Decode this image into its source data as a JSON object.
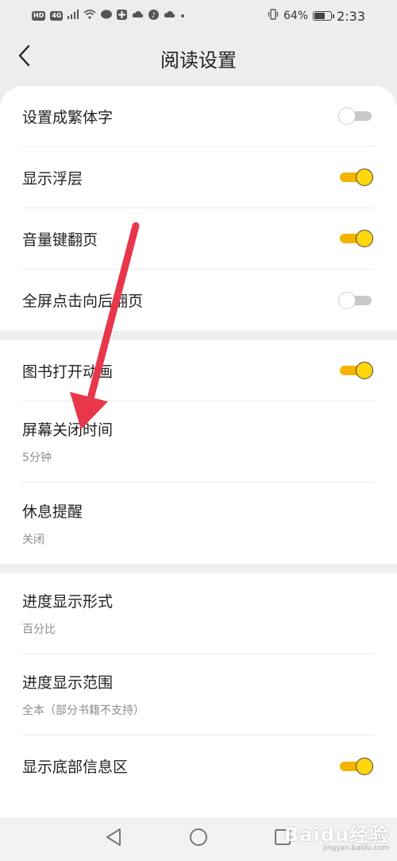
{
  "status_bar": {
    "badge_hd": "HD",
    "badge_net": "4G",
    "battery_text": "64%",
    "battery_level": 0.64,
    "time": "2:33"
  },
  "header": {
    "title": "阅读设置"
  },
  "groups": [
    {
      "rows": [
        {
          "title": "设置成繁体字",
          "toggle": false
        },
        {
          "title": "显示浮层",
          "toggle": true
        },
        {
          "title": "音量键翻页",
          "toggle": true
        },
        {
          "title": "全屏点击向后翻页",
          "toggle": false
        }
      ]
    },
    {
      "rows": [
        {
          "title": "图书打开动画",
          "toggle": true
        },
        {
          "title": "屏幕关闭时间",
          "subtitle": "5分钟"
        },
        {
          "title": "休息提醒",
          "subtitle": "关闭"
        }
      ]
    },
    {
      "rows": [
        {
          "title": "进度显示形式",
          "subtitle": "百分比"
        },
        {
          "title": "进度显示范围",
          "subtitle": "全本（部分书籍不支持）"
        },
        {
          "title": "显示底部信息区",
          "toggle": true
        }
      ]
    }
  ],
  "watermark": {
    "text": "Baidu经验",
    "url": "jingyan.baidu.com"
  },
  "colors": {
    "accent": "#ffd60a",
    "track_on": "#f5b200",
    "annotation_arrow": "#e8374a"
  },
  "icons": {
    "back": "chevron-left-icon",
    "nav_back": "triangle-back-icon",
    "nav_home": "circle-home-icon",
    "nav_recent": "square-recent-icon"
  }
}
